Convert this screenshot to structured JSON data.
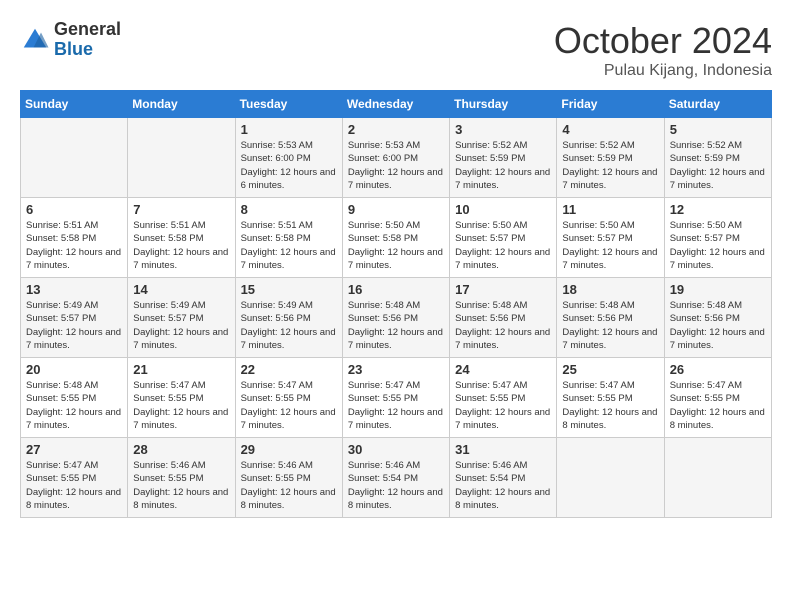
{
  "header": {
    "logo": {
      "general": "General",
      "blue": "Blue"
    },
    "title": "October 2024",
    "subtitle": "Pulau Kijang, Indonesia"
  },
  "days": [
    "Sunday",
    "Monday",
    "Tuesday",
    "Wednesday",
    "Thursday",
    "Friday",
    "Saturday"
  ],
  "weeks": [
    [
      {
        "day": "",
        "content": ""
      },
      {
        "day": "",
        "content": ""
      },
      {
        "day": "1",
        "content": "Sunrise: 5:53 AM\nSunset: 6:00 PM\nDaylight: 12 hours and 6 minutes."
      },
      {
        "day": "2",
        "content": "Sunrise: 5:53 AM\nSunset: 6:00 PM\nDaylight: 12 hours and 7 minutes."
      },
      {
        "day": "3",
        "content": "Sunrise: 5:52 AM\nSunset: 5:59 PM\nDaylight: 12 hours and 7 minutes."
      },
      {
        "day": "4",
        "content": "Sunrise: 5:52 AM\nSunset: 5:59 PM\nDaylight: 12 hours and 7 minutes."
      },
      {
        "day": "5",
        "content": "Sunrise: 5:52 AM\nSunset: 5:59 PM\nDaylight: 12 hours and 7 minutes."
      }
    ],
    [
      {
        "day": "6",
        "content": "Sunrise: 5:51 AM\nSunset: 5:58 PM\nDaylight: 12 hours and 7 minutes."
      },
      {
        "day": "7",
        "content": "Sunrise: 5:51 AM\nSunset: 5:58 PM\nDaylight: 12 hours and 7 minutes."
      },
      {
        "day": "8",
        "content": "Sunrise: 5:51 AM\nSunset: 5:58 PM\nDaylight: 12 hours and 7 minutes."
      },
      {
        "day": "9",
        "content": "Sunrise: 5:50 AM\nSunset: 5:58 PM\nDaylight: 12 hours and 7 minutes."
      },
      {
        "day": "10",
        "content": "Sunrise: 5:50 AM\nSunset: 5:57 PM\nDaylight: 12 hours and 7 minutes."
      },
      {
        "day": "11",
        "content": "Sunrise: 5:50 AM\nSunset: 5:57 PM\nDaylight: 12 hours and 7 minutes."
      },
      {
        "day": "12",
        "content": "Sunrise: 5:50 AM\nSunset: 5:57 PM\nDaylight: 12 hours and 7 minutes."
      }
    ],
    [
      {
        "day": "13",
        "content": "Sunrise: 5:49 AM\nSunset: 5:57 PM\nDaylight: 12 hours and 7 minutes."
      },
      {
        "day": "14",
        "content": "Sunrise: 5:49 AM\nSunset: 5:57 PM\nDaylight: 12 hours and 7 minutes."
      },
      {
        "day": "15",
        "content": "Sunrise: 5:49 AM\nSunset: 5:56 PM\nDaylight: 12 hours and 7 minutes."
      },
      {
        "day": "16",
        "content": "Sunrise: 5:48 AM\nSunset: 5:56 PM\nDaylight: 12 hours and 7 minutes."
      },
      {
        "day": "17",
        "content": "Sunrise: 5:48 AM\nSunset: 5:56 PM\nDaylight: 12 hours and 7 minutes."
      },
      {
        "day": "18",
        "content": "Sunrise: 5:48 AM\nSunset: 5:56 PM\nDaylight: 12 hours and 7 minutes."
      },
      {
        "day": "19",
        "content": "Sunrise: 5:48 AM\nSunset: 5:56 PM\nDaylight: 12 hours and 7 minutes."
      }
    ],
    [
      {
        "day": "20",
        "content": "Sunrise: 5:48 AM\nSunset: 5:55 PM\nDaylight: 12 hours and 7 minutes."
      },
      {
        "day": "21",
        "content": "Sunrise: 5:47 AM\nSunset: 5:55 PM\nDaylight: 12 hours and 7 minutes."
      },
      {
        "day": "22",
        "content": "Sunrise: 5:47 AM\nSunset: 5:55 PM\nDaylight: 12 hours and 7 minutes."
      },
      {
        "day": "23",
        "content": "Sunrise: 5:47 AM\nSunset: 5:55 PM\nDaylight: 12 hours and 7 minutes."
      },
      {
        "day": "24",
        "content": "Sunrise: 5:47 AM\nSunset: 5:55 PM\nDaylight: 12 hours and 7 minutes."
      },
      {
        "day": "25",
        "content": "Sunrise: 5:47 AM\nSunset: 5:55 PM\nDaylight: 12 hours and 8 minutes."
      },
      {
        "day": "26",
        "content": "Sunrise: 5:47 AM\nSunset: 5:55 PM\nDaylight: 12 hours and 8 minutes."
      }
    ],
    [
      {
        "day": "27",
        "content": "Sunrise: 5:47 AM\nSunset: 5:55 PM\nDaylight: 12 hours and 8 minutes."
      },
      {
        "day": "28",
        "content": "Sunrise: 5:46 AM\nSunset: 5:55 PM\nDaylight: 12 hours and 8 minutes."
      },
      {
        "day": "29",
        "content": "Sunrise: 5:46 AM\nSunset: 5:55 PM\nDaylight: 12 hours and 8 minutes."
      },
      {
        "day": "30",
        "content": "Sunrise: 5:46 AM\nSunset: 5:54 PM\nDaylight: 12 hours and 8 minutes."
      },
      {
        "day": "31",
        "content": "Sunrise: 5:46 AM\nSunset: 5:54 PM\nDaylight: 12 hours and 8 minutes."
      },
      {
        "day": "",
        "content": ""
      },
      {
        "day": "",
        "content": ""
      }
    ]
  ]
}
